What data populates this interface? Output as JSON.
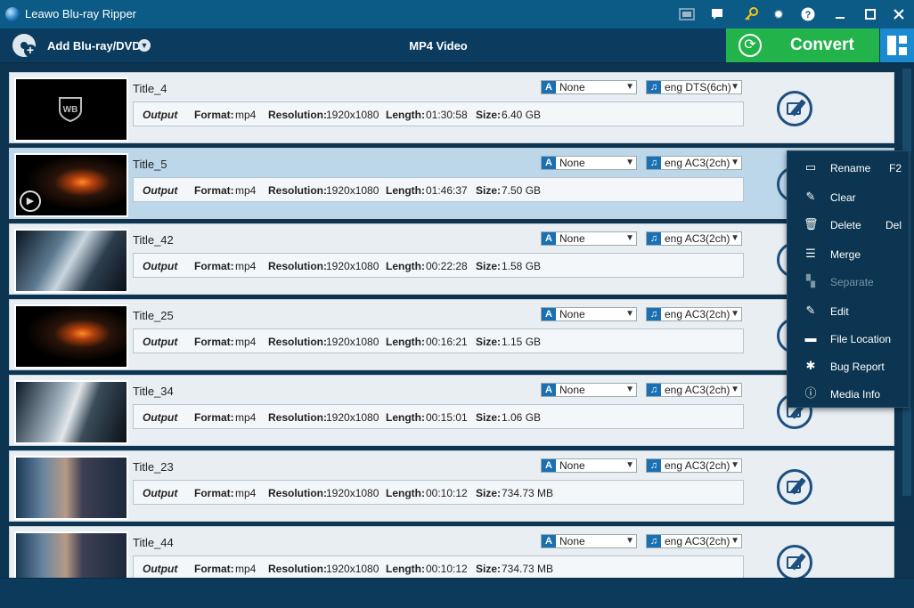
{
  "window": {
    "title": "Leawo Blu-ray Ripper"
  },
  "toolbar": {
    "add_label": "Add Blu-ray/DVD",
    "profile": "MP4 Video",
    "convert_label": "Convert"
  },
  "rows": [
    {
      "title": "Title_4",
      "subtitle": "None",
      "audio": "eng DTS(6ch)",
      "output": "Output",
      "format_label": "Format:",
      "format": "mp4",
      "res_label": "Resolution:",
      "resolution": "1920x1080",
      "len_label": "Length:",
      "length": "01:30:58",
      "size_label": "Size:",
      "size": "6.40 GB",
      "selected": false
    },
    {
      "title": "Title_5",
      "subtitle": "None",
      "audio": "eng AC3(2ch)",
      "output": "Output",
      "format_label": "Format:",
      "format": "mp4",
      "res_label": "Resolution:",
      "resolution": "1920x1080",
      "len_label": "Length:",
      "length": "01:46:37",
      "size_label": "Size:",
      "size": "7.50 GB",
      "selected": true
    },
    {
      "title": "Title_42",
      "subtitle": "None",
      "audio": "eng AC3(2ch)",
      "output": "Output",
      "format_label": "Format:",
      "format": "mp4",
      "res_label": "Resolution:",
      "resolution": "1920x1080",
      "len_label": "Length:",
      "length": "00:22:28",
      "size_label": "Size:",
      "size": "1.58 GB",
      "selected": false
    },
    {
      "title": "Title_25",
      "subtitle": "None",
      "audio": "eng AC3(2ch)",
      "output": "Output",
      "format_label": "Format:",
      "format": "mp4",
      "res_label": "Resolution:",
      "resolution": "1920x1080",
      "len_label": "Length:",
      "length": "00:16:21",
      "size_label": "Size:",
      "size": "1.15 GB",
      "selected": false
    },
    {
      "title": "Title_34",
      "subtitle": "None",
      "audio": "eng AC3(2ch)",
      "output": "Output",
      "format_label": "Format:",
      "format": "mp4",
      "res_label": "Resolution:",
      "resolution": "1920x1080",
      "len_label": "Length:",
      "length": "00:15:01",
      "size_label": "Size:",
      "size": "1.06 GB",
      "selected": false
    },
    {
      "title": "Title_23",
      "subtitle": "None",
      "audio": "eng AC3(2ch)",
      "output": "Output",
      "format_label": "Format:",
      "format": "mp4",
      "res_label": "Resolution:",
      "resolution": "1920x1080",
      "len_label": "Length:",
      "length": "00:10:12",
      "size_label": "Size:",
      "size": "734.73 MB",
      "selected": false
    },
    {
      "title": "Title_44",
      "subtitle": "None",
      "audio": "eng AC3(2ch)",
      "output": "Output",
      "format_label": "Format:",
      "format": "mp4",
      "res_label": "Resolution:",
      "resolution": "1920x1080",
      "len_label": "Length:",
      "length": "00:10:12",
      "size_label": "Size:",
      "size": "734.73 MB",
      "selected": false
    }
  ],
  "context_menu": [
    {
      "label": "Rename",
      "shortcut": "F2",
      "icon": "rename-icon",
      "disabled": false
    },
    {
      "label": "Clear",
      "shortcut": "",
      "icon": "broom-icon",
      "disabled": false
    },
    {
      "label": "Delete",
      "shortcut": "Del",
      "icon": "trash-icon",
      "disabled": false
    },
    {
      "label": "Merge",
      "shortcut": "",
      "icon": "merge-icon",
      "disabled": false
    },
    {
      "label": "Separate",
      "shortcut": "",
      "icon": "separate-icon",
      "disabled": true
    },
    {
      "label": "Edit",
      "shortcut": "",
      "icon": "edit-icon",
      "disabled": false
    },
    {
      "label": "File Location",
      "shortcut": "",
      "icon": "folder-icon",
      "disabled": false
    },
    {
      "label": "Bug Report",
      "shortcut": "",
      "icon": "bug-icon",
      "disabled": false
    },
    {
      "label": "Media Info",
      "shortcut": "",
      "icon": "info-icon",
      "disabled": false
    }
  ],
  "colors": {
    "titlebar": "#0c5a86",
    "convert": "#22b34b",
    "selected_row": "#bcd6ea"
  }
}
